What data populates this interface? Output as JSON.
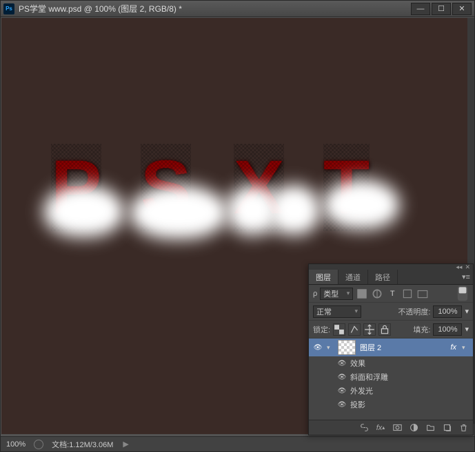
{
  "window": {
    "title": "PS学堂 www.psd @ 100% (图层 2, RGB/8) *"
  },
  "artwork": {
    "letters": [
      "P",
      "S",
      "X",
      "T"
    ]
  },
  "statusbar": {
    "zoom": "100%",
    "docinfo": "文档:1.12M/3.06M"
  },
  "panel": {
    "tabs": {
      "layers": "图层",
      "channels": "通道",
      "paths": "路径"
    },
    "filter_row": {
      "kind_icon": "ρ",
      "kind_label": "类型"
    },
    "blend_row": {
      "mode": "正常",
      "opacity_label": "不透明度:",
      "opacity_value": "100%"
    },
    "lock_row": {
      "lock_label": "锁定:",
      "fill_label": "填充:",
      "fill_value": "100%"
    },
    "layers": {
      "active": {
        "name": "图层 2",
        "fx": "fx"
      },
      "effects_header": "效果",
      "effects": [
        "斜面和浮雕",
        "外发光",
        "投影"
      ]
    }
  }
}
